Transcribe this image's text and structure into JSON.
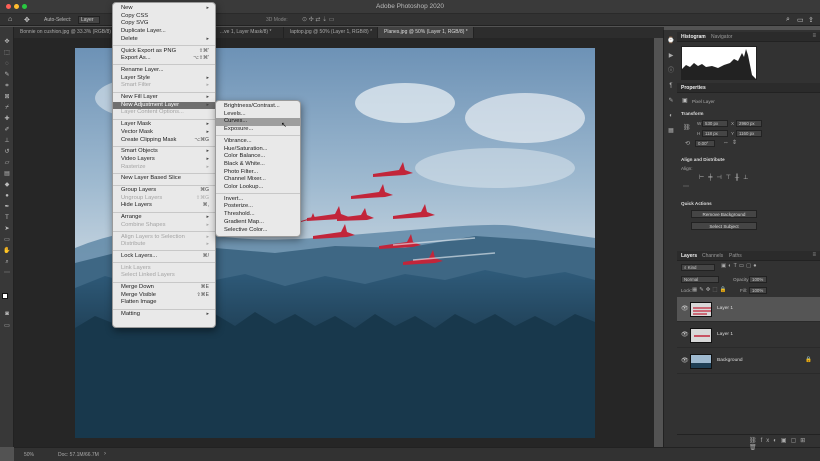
{
  "app": {
    "title": "Adobe Photoshop 2020"
  },
  "options_bar": {
    "auto_select_label": "Auto-Select:",
    "auto_select_value": "Layer",
    "mode_3d": "3D Mode:"
  },
  "doc_tabs": [
    {
      "label": "Bonnie on cushion.jpg @ 33.3% (RGB/8) *"
    },
    {
      "label": "...ve 1, Layer Mask/8) *"
    },
    {
      "label": "laptop.jpg @ 50% (Layer 1, RGB/8) *"
    },
    {
      "label": "Planes.jpg @ 50% (Layer 1, RGB/8) *",
      "active": true
    }
  ],
  "status": {
    "zoom": "50%",
    "doc": "Doc: 57.1M/66.7M"
  },
  "layer_menu": {
    "items": [
      {
        "label": "New",
        "sub": true
      },
      {
        "label": "Copy CSS"
      },
      {
        "label": "Copy SVG"
      },
      {
        "label": "Duplicate Layer..."
      },
      {
        "label": "Delete",
        "sub": true
      },
      {
        "sep": true
      },
      {
        "label": "Quick Export as PNG",
        "shortcut": "⇧⌘'"
      },
      {
        "label": "Export As...",
        "shortcut": "⌥⇧⌘'"
      },
      {
        "sep": true
      },
      {
        "label": "Rename Layer..."
      },
      {
        "label": "Layer Style",
        "sub": true
      },
      {
        "label": "Smart Filter",
        "sub": true,
        "disabled": true
      },
      {
        "sep": true
      },
      {
        "label": "New Fill Layer",
        "sub": true
      },
      {
        "label": "New Adjustment Layer",
        "sub": true,
        "highlight": true
      },
      {
        "label": "Layer Content Options...",
        "disabled": true
      },
      {
        "sep": true
      },
      {
        "label": "Layer Mask",
        "sub": true
      },
      {
        "label": "Vector Mask",
        "sub": true
      },
      {
        "label": "Create Clipping Mask",
        "shortcut": "⌥⌘G"
      },
      {
        "sep": true
      },
      {
        "label": "Smart Objects",
        "sub": true
      },
      {
        "label": "Video Layers",
        "sub": true
      },
      {
        "label": "Rasterize",
        "sub": true,
        "disabled": true
      },
      {
        "sep": true
      },
      {
        "label": "New Layer Based Slice"
      },
      {
        "sep": true
      },
      {
        "label": "Group Layers",
        "shortcut": "⌘G"
      },
      {
        "label": "Ungroup Layers",
        "shortcut": "⇧⌘G",
        "disabled": true
      },
      {
        "label": "Hide Layers",
        "shortcut": "⌘,"
      },
      {
        "sep": true
      },
      {
        "label": "Arrange",
        "sub": true
      },
      {
        "label": "Combine Shapes",
        "sub": true,
        "disabled": true
      },
      {
        "sep": true
      },
      {
        "label": "Align Layers to Selection",
        "sub": true,
        "disabled": true
      },
      {
        "label": "Distribute",
        "sub": true,
        "disabled": true
      },
      {
        "sep": true
      },
      {
        "label": "Lock Layers...",
        "shortcut": "⌘/"
      },
      {
        "sep": true
      },
      {
        "label": "Link Layers",
        "disabled": true
      },
      {
        "label": "Select Linked Layers",
        "disabled": true
      },
      {
        "sep": true
      },
      {
        "label": "Merge Down",
        "shortcut": "⌘E"
      },
      {
        "label": "Merge Visible",
        "shortcut": "⇧⌘E"
      },
      {
        "label": "Flatten Image"
      },
      {
        "sep": true
      },
      {
        "label": "Matting",
        "sub": true
      }
    ]
  },
  "adjust_menu": {
    "items": [
      {
        "label": "Brightness/Contrast..."
      },
      {
        "label": "Levels..."
      },
      {
        "label": "Curves...",
        "highlight": true
      },
      {
        "label": "Exposure..."
      },
      {
        "sep": true
      },
      {
        "label": "Vibrance..."
      },
      {
        "label": "Hue/Saturation..."
      },
      {
        "label": "Color Balance..."
      },
      {
        "label": "Black & White..."
      },
      {
        "label": "Photo Filter..."
      },
      {
        "label": "Channel Mixer..."
      },
      {
        "label": "Color Lookup..."
      },
      {
        "sep": true
      },
      {
        "label": "Invert..."
      },
      {
        "label": "Posterize..."
      },
      {
        "label": "Threshold..."
      },
      {
        "label": "Gradient Map..."
      },
      {
        "label": "Selective Color..."
      }
    ]
  },
  "histogram_panel": {
    "tab1": "Histogram",
    "tab2": "Navigator"
  },
  "properties_panel": {
    "title": "Properties",
    "kind": "Pixel Layer",
    "transform": "Transform",
    "w_label": "W",
    "w_value": "530 px",
    "h_label": "H",
    "h_value": "118 px",
    "x_label": "X",
    "x_value": "2960 px",
    "y_label": "Y",
    "y_value": "1160 px",
    "angle": "0.00°",
    "align_title": "Align and Distribute",
    "align_label": "Align:",
    "quick_actions": "Quick Actions",
    "remove_bg": "Remove Background",
    "select_subject": "Select Subject"
  },
  "layers_panel": {
    "tabs": [
      "Layers",
      "Channels",
      "Paths"
    ],
    "kind": "Kind",
    "blend": "Normal",
    "opacity_label": "Opacity:",
    "opacity": "100%",
    "lock_label": "Lock:",
    "fill_label": "Fill:",
    "fill": "100%",
    "layers": [
      {
        "name": "Layer 1",
        "selected": true
      },
      {
        "name": "Layer 1"
      },
      {
        "name": "Background",
        "locked": true
      }
    ]
  },
  "colors": {
    "accent": "#2d63d8",
    "panel": "#323232",
    "menu_bg": "#e9e9e9"
  }
}
